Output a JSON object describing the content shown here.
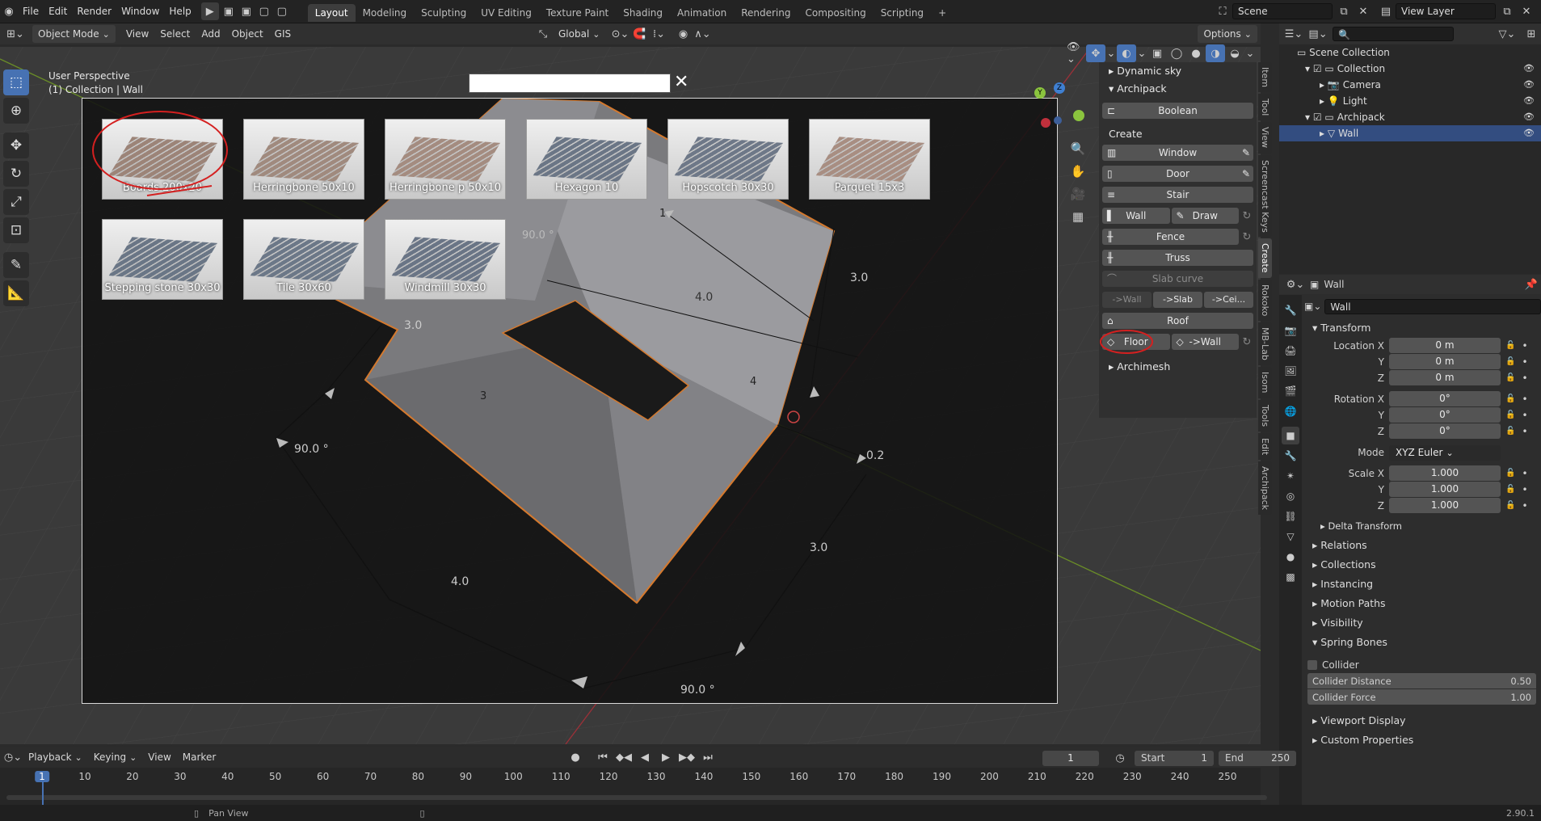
{
  "topbar": {
    "menus": [
      "File",
      "Edit",
      "Render",
      "Window",
      "Help"
    ],
    "workspaces": [
      "Layout",
      "Modeling",
      "Sculpting",
      "UV Editing",
      "Texture Paint",
      "Shading",
      "Animation",
      "Rendering",
      "Compositing",
      "Scripting"
    ],
    "add_tab": "+",
    "scene": "Scene",
    "view_layer": "View Layer"
  },
  "viewport_header": {
    "mode": "Object Mode",
    "menus": [
      "View",
      "Select",
      "Add",
      "Object",
      "GIS"
    ],
    "orientation": "Global",
    "options": "Options"
  },
  "viewport": {
    "perspective": "User Perspective",
    "collection": "(1) Collection | Wall",
    "dims": {
      "top_center": "1",
      "angle_top": "90.0 °",
      "right_upper": "3.0",
      "back_len": "4.0",
      "left_upper": "3.0",
      "face_left": "3",
      "face_right": "4",
      "angle_left": "90.0 °",
      "small_right": "0.2",
      "right_lower": "3.0",
      "front_len": "4.0",
      "angle_bottom": "90.0 °"
    }
  },
  "browser": {
    "search_value": "",
    "close": "✕",
    "items": [
      {
        "label": "Boards 200x20",
        "color": "#9c8478"
      },
      {
        "label": "Herringbone 50x10",
        "color": "#a08a7e"
      },
      {
        "label": "Herringbone p 50x10",
        "color": "#a48c80"
      },
      {
        "label": "Hexagon 10",
        "color": "#6b7686"
      },
      {
        "label": "Hopscotch 30x30",
        "color": "#6e7888"
      },
      {
        "label": "Parquet 15x3",
        "color": "#a88e82"
      },
      {
        "label": "Stepping stone 30x30",
        "color": "#6a7686"
      },
      {
        "label": "Tile 30x60",
        "color": "#6c7888"
      },
      {
        "label": "Windmill 30x30",
        "color": "#6a7586"
      }
    ]
  },
  "npanel": {
    "dynamic_sky": "Dynamic sky",
    "archipack": "Archipack",
    "boolean": "Boolean",
    "create": "Create",
    "window": "Window",
    "door": "Door",
    "stair": "Stair",
    "wall": "Wall",
    "draw": "Draw",
    "fence": "Fence",
    "truss": "Truss",
    "slab_curve": "Slab curve",
    "to_wall": "->Wall",
    "to_slab": "->Slab",
    "to_ceil": "->Cei...",
    "roof": "Roof",
    "floor": "Floor",
    "floor_to_wall": "->Wall",
    "archimesh": "Archimesh"
  },
  "vtabs": [
    "Item",
    "Tool",
    "View",
    "Screencast Keys",
    "Create",
    "Rokoko",
    "MB-Lab",
    "Isom",
    "Tools",
    "Edit",
    "Archipack"
  ],
  "outliner": {
    "root": "Scene Collection",
    "rows": [
      {
        "label": "Collection",
        "indent": 1,
        "icon": "▭"
      },
      {
        "label": "Camera",
        "indent": 2,
        "icon": "📷"
      },
      {
        "label": "Light",
        "indent": 2,
        "icon": "💡"
      },
      {
        "label": "Archipack",
        "indent": 1,
        "icon": "▭"
      },
      {
        "label": "Wall",
        "indent": 2,
        "icon": "▽"
      }
    ]
  },
  "properties": {
    "object_name": "Wall",
    "name_field": "Wall",
    "transform": "Transform",
    "location": [
      {
        "label": "Location X",
        "val": "0 m"
      },
      {
        "label": "Y",
        "val": "0 m"
      },
      {
        "label": "Z",
        "val": "0 m"
      }
    ],
    "rotation": [
      {
        "label": "Rotation X",
        "val": "0°"
      },
      {
        "label": "Y",
        "val": "0°"
      },
      {
        "label": "Z",
        "val": "0°"
      }
    ],
    "mode_label": "Mode",
    "mode_val": "XYZ Euler",
    "scale": [
      {
        "label": "Scale X",
        "val": "1.000"
      },
      {
        "label": "Y",
        "val": "1.000"
      },
      {
        "label": "Z",
        "val": "1.000"
      }
    ],
    "delta": "Delta Transform",
    "sections": [
      "Relations",
      "Collections",
      "Instancing",
      "Motion Paths",
      "Visibility"
    ],
    "spring_bones": "Spring Bones",
    "collider": "Collider",
    "collider_distance_label": "Collider Distance",
    "collider_distance": "0.50",
    "collider_force_label": "Collider Force",
    "collider_force": "1.00",
    "sections2": [
      "Viewport Display",
      "Custom Properties"
    ]
  },
  "timeline": {
    "menus": [
      "Playback",
      "Keying",
      "View",
      "Marker"
    ],
    "current_frame": "1",
    "start_label": "Start",
    "start": "1",
    "end_label": "End",
    "end": "250",
    "ticks": [
      "1",
      "10",
      "20",
      "30",
      "40",
      "50",
      "60",
      "70",
      "80",
      "90",
      "100",
      "110",
      "120",
      "130",
      "140",
      "150",
      "160",
      "170",
      "180",
      "190",
      "200",
      "210",
      "220",
      "230",
      "240",
      "250"
    ]
  },
  "status": {
    "pan": "Pan View",
    "version": "2.90.1"
  }
}
